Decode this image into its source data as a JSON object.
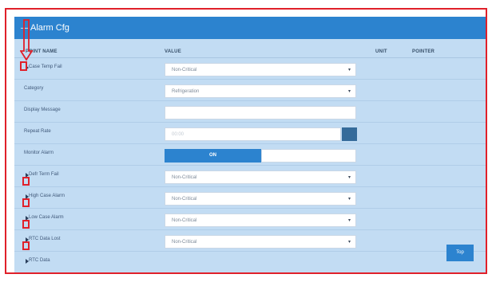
{
  "panel": {
    "title_icon": "—",
    "title": "Alarm Cfg",
    "columns": {
      "point_name": "POINT NAME",
      "value": "VALUE",
      "unit": "UNIT",
      "pointer": "POINTER"
    }
  },
  "rows": [
    {
      "label": "Case Temp Fail",
      "kind": "select",
      "value": "Non-Critical"
    },
    {
      "label": "Category",
      "kind": "select",
      "value": "Refrigeration"
    },
    {
      "label": "Display Message",
      "kind": "text",
      "value": ""
    },
    {
      "label": "Repeat Rate",
      "kind": "text-button",
      "placeholder": "00:00"
    },
    {
      "label": "Monitor Alarm",
      "kind": "toggle",
      "on_label": "ON",
      "off_label": ""
    },
    {
      "label": "Defr Term Fail",
      "kind": "select",
      "value": "Non-Critical"
    },
    {
      "label": "High Case Alarm",
      "kind": "select",
      "value": "Non-Critical"
    },
    {
      "label": "Low Case Alarm",
      "kind": "select",
      "value": "Non-Critical"
    },
    {
      "label": "RTC Data Lost",
      "kind": "select",
      "value": "Non-Critical"
    }
  ],
  "next_row_label": "RTC Data",
  "top_button_label": "Top",
  "dropdown_caret": "▾",
  "colors": {
    "accent": "#2c83cf",
    "panel_bg": "#c2dcf3",
    "highlight": "#e0202a"
  }
}
